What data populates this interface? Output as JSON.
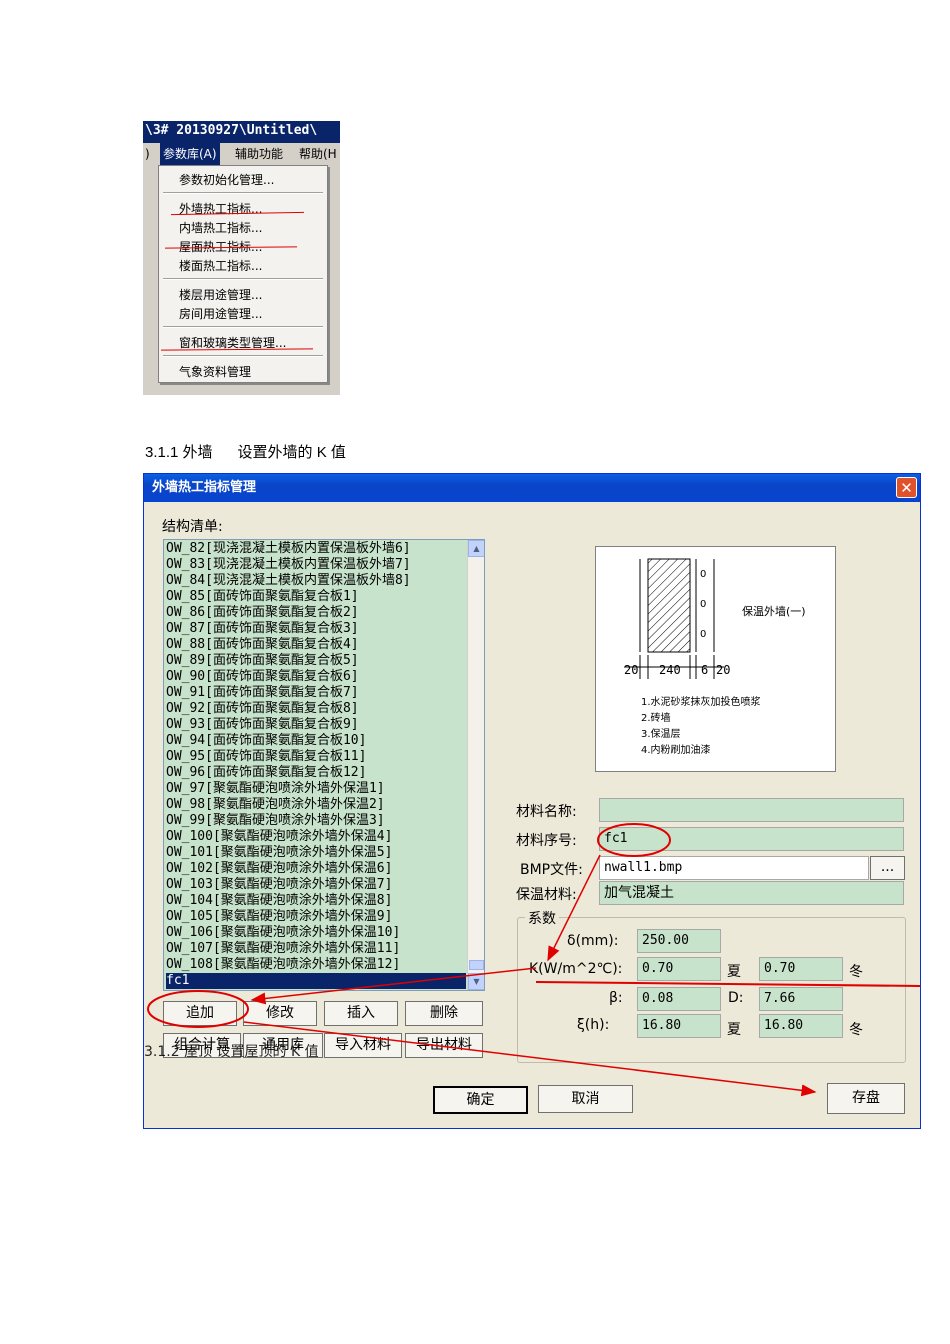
{
  "menu_window": {
    "title": "\\3#  20130927\\Untitled\\",
    "menubar": {
      "partial": ")",
      "param_lib": "参数库(A)",
      "assist": "辅助功能",
      "help": "帮助(H"
    },
    "items": [
      "参数初始化管理...",
      "外墙热工指标...",
      "内墙热工指标...",
      "屋面热工指标...",
      "楼面热工指标...",
      "楼层用途管理...",
      "房间用途管理...",
      "窗和玻璃类型管理...",
      "气象资料管理"
    ]
  },
  "caption": "3.1.1 外墙      设置外墙的 K 值",
  "dialog": {
    "title": "外墙热工指标管理",
    "list_label": "结构清单:",
    "list_items": [
      "OW_82[现浇混凝土模板内置保温板外墙6]",
      "OW_83[现浇混凝土模板内置保温板外墙7]",
      "OW_84[现浇混凝土模板内置保温板外墙8]",
      "OW_85[面砖饰面聚氨酯复合板1]",
      "OW_86[面砖饰面聚氨酯复合板2]",
      "OW_87[面砖饰面聚氨酯复合板3]",
      "OW_88[面砖饰面聚氨酯复合板4]",
      "OW_89[面砖饰面聚氨酯复合板5]",
      "OW_90[面砖饰面聚氨酯复合板6]",
      "OW_91[面砖饰面聚氨酯复合板7]",
      "OW_92[面砖饰面聚氨酯复合板8]",
      "OW_93[面砖饰面聚氨酯复合板9]",
      "OW_94[面砖饰面聚氨酯复合板10]",
      "OW_95[面砖饰面聚氨酯复合板11]",
      "OW_96[面砖饰面聚氨酯复合板12]",
      "OW_97[聚氨酯硬泡喷涂外墙外保温1]",
      "OW_98[聚氨酯硬泡喷涂外墙外保温2]",
      "OW_99[聚氨酯硬泡喷涂外墙外保温3]",
      "OW_100[聚氨酯硬泡喷涂外墙外保温4]",
      "OW_101[聚氨酯硬泡喷涂外墙外保温5]",
      "OW_102[聚氨酯硬泡喷涂外墙外保温6]",
      "OW_103[聚氨酯硬泡喷涂外墙外保温7]",
      "OW_104[聚氨酯硬泡喷涂外墙外保温8]",
      "OW_105[聚氨酯硬泡喷涂外墙外保温9]",
      "OW_106[聚氨酯硬泡喷涂外墙外保温10]",
      "OW_107[聚氨酯硬泡喷涂外墙外保温11]",
      "OW_108[聚氨酯硬泡喷涂外墙外保温12]",
      "fc1"
    ],
    "buttons": {
      "add": "追加",
      "modify": "修改",
      "insert": "插入",
      "delete": "删除",
      "combo_calc": "组合计算",
      "common_lib": "通用库",
      "import_material": "导入材料",
      "export_material": "导出材料",
      "ok": "确定",
      "cancel": "取消",
      "save": "存盘",
      "browse": "..."
    },
    "preview": {
      "title": "保温外墙(一)",
      "dims": [
        "20",
        "240",
        "6",
        "20"
      ],
      "notes": [
        "1.水泥砂浆抹灰加投色喷浆",
        "2.砖墙",
        "3.保温层",
        "4.内粉刷加油漆"
      ]
    },
    "fields": {
      "material_name_label": "材料名称:",
      "material_name": "",
      "material_no_label": "材料序号:",
      "material_no": "fc1",
      "bmp_label": "BMP文件:",
      "bmp": "nwall1.bmp",
      "insulation_label": "保温材料:",
      "insulation": "加气混凝土"
    },
    "coef": {
      "group_label": "系数",
      "delta_label": "δ(mm):",
      "delta": "250.00",
      "k_label": "K(W/m^2℃):",
      "k_summer": "0.70",
      "k_winter": "0.70",
      "beta_label": "β:",
      "beta": "0.08",
      "d_label": "D:",
      "d": "7.66",
      "xi_label": "ξ(h):",
      "xi_summer": "16.80",
      "xi_winter": "16.80",
      "summer": "夏",
      "winter": "冬"
    },
    "overlay_text": "3.1.2 屋顶    设置屋顶的 K 值"
  }
}
